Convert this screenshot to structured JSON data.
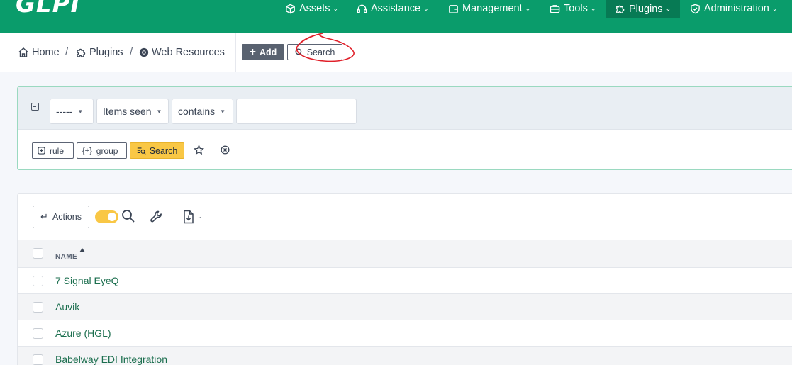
{
  "app": {
    "logo": "GLPI"
  },
  "nav": {
    "items": [
      {
        "label": "Assets",
        "icon": "cube-icon"
      },
      {
        "label": "Assistance",
        "icon": "headset-icon"
      },
      {
        "label": "Management",
        "icon": "wallet-icon"
      },
      {
        "label": "Tools",
        "icon": "briefcase-icon"
      },
      {
        "label": "Plugins",
        "icon": "puzzle-icon",
        "active": true
      },
      {
        "label": "Administration",
        "icon": "shield-check-icon"
      }
    ]
  },
  "breadcrumb": {
    "items": [
      {
        "label": "Home",
        "icon": "home-icon"
      },
      {
        "label": "Plugins",
        "icon": "puzzle-icon"
      },
      {
        "label": "Web Resources",
        "icon": "chrome-icon"
      }
    ],
    "separator": "/"
  },
  "header": {
    "add_label": "Add",
    "search_label": "Search"
  },
  "criteria": {
    "field_1": "-----",
    "field_2": "Items seen",
    "field_3": "contains",
    "value": "",
    "rule_label": "rule",
    "group_label": "group",
    "search_label": "Search"
  },
  "results": {
    "actions_label": "Actions",
    "toggle_on": true,
    "column_name": "NAME",
    "rows": [
      {
        "name": "7 Signal EyeQ"
      },
      {
        "name": "Auvik"
      },
      {
        "name": "Azure (HGL)"
      },
      {
        "name": "Babelway EDI Integration"
      }
    ]
  },
  "colors": {
    "brand": "#0a9c6b",
    "brand_active": "#077a54",
    "accent_yellow": "#f9c745",
    "link_green": "#1b6e4e",
    "annotation_red": "#e0202a"
  }
}
